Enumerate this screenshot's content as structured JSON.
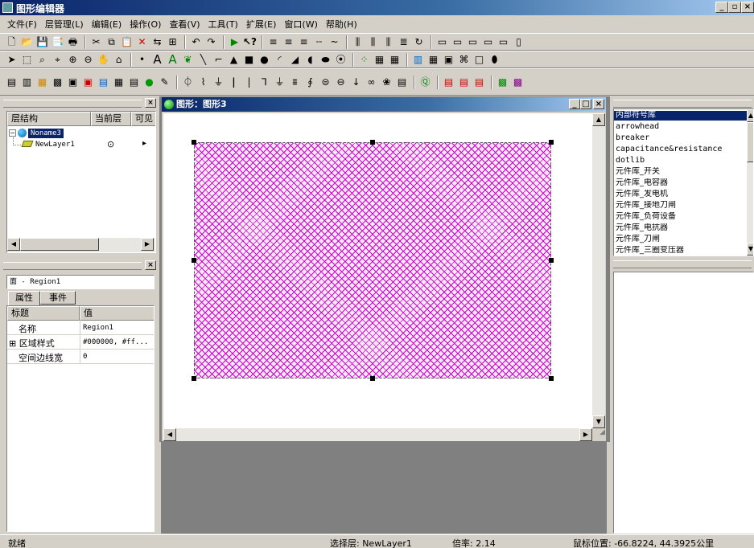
{
  "window": {
    "title": "图形编辑器"
  },
  "menu": [
    "文件(F)",
    "层管理(L)",
    "编辑(E)",
    "操作(O)",
    "查看(V)",
    "工具(T)",
    "扩展(E)",
    "窗口(W)",
    "帮助(H)"
  ],
  "layer_panel": {
    "col_structure": "层结构",
    "col_current": "当前层",
    "col_visible": "可见",
    "root": "Noname3",
    "layer": "NewLayer1",
    "current_mark": "⊙",
    "visible_mark": "▸"
  },
  "props_panel": {
    "object_label": "面 - Region1",
    "tab_props": "属性",
    "tab_events": "事件",
    "col_title": "标题",
    "col_value": "值",
    "rows": [
      {
        "name": "名称",
        "value": "Region1"
      },
      {
        "name": "⊞ 区域样式",
        "value": "#000000, #ff..."
      },
      {
        "name": "空间边线宽",
        "value": "0"
      }
    ]
  },
  "document": {
    "title": "图形：图形3"
  },
  "symbol_library": [
    "内部符号库",
    "arrowhead",
    "breaker",
    "capacitance&resistance",
    "dotlib",
    "元件库_开关",
    "元件库_电容器",
    "元件库_发电机",
    "元件库_接地刀闸",
    "元件库_负荷设备",
    "元件库_电抗器",
    "元件库_刀闸",
    "元件库_三圈变压器"
  ],
  "status": {
    "ready": "就绪",
    "layer": "选择层: NewLayer1",
    "zoom": "倍率: 2.14",
    "mouse": "鼠标位置: -66.8224, 44.3925公里"
  },
  "colors": {
    "hatch": "#d000d0",
    "selection": "#0a246a",
    "chrome": "#d4d0c8"
  }
}
